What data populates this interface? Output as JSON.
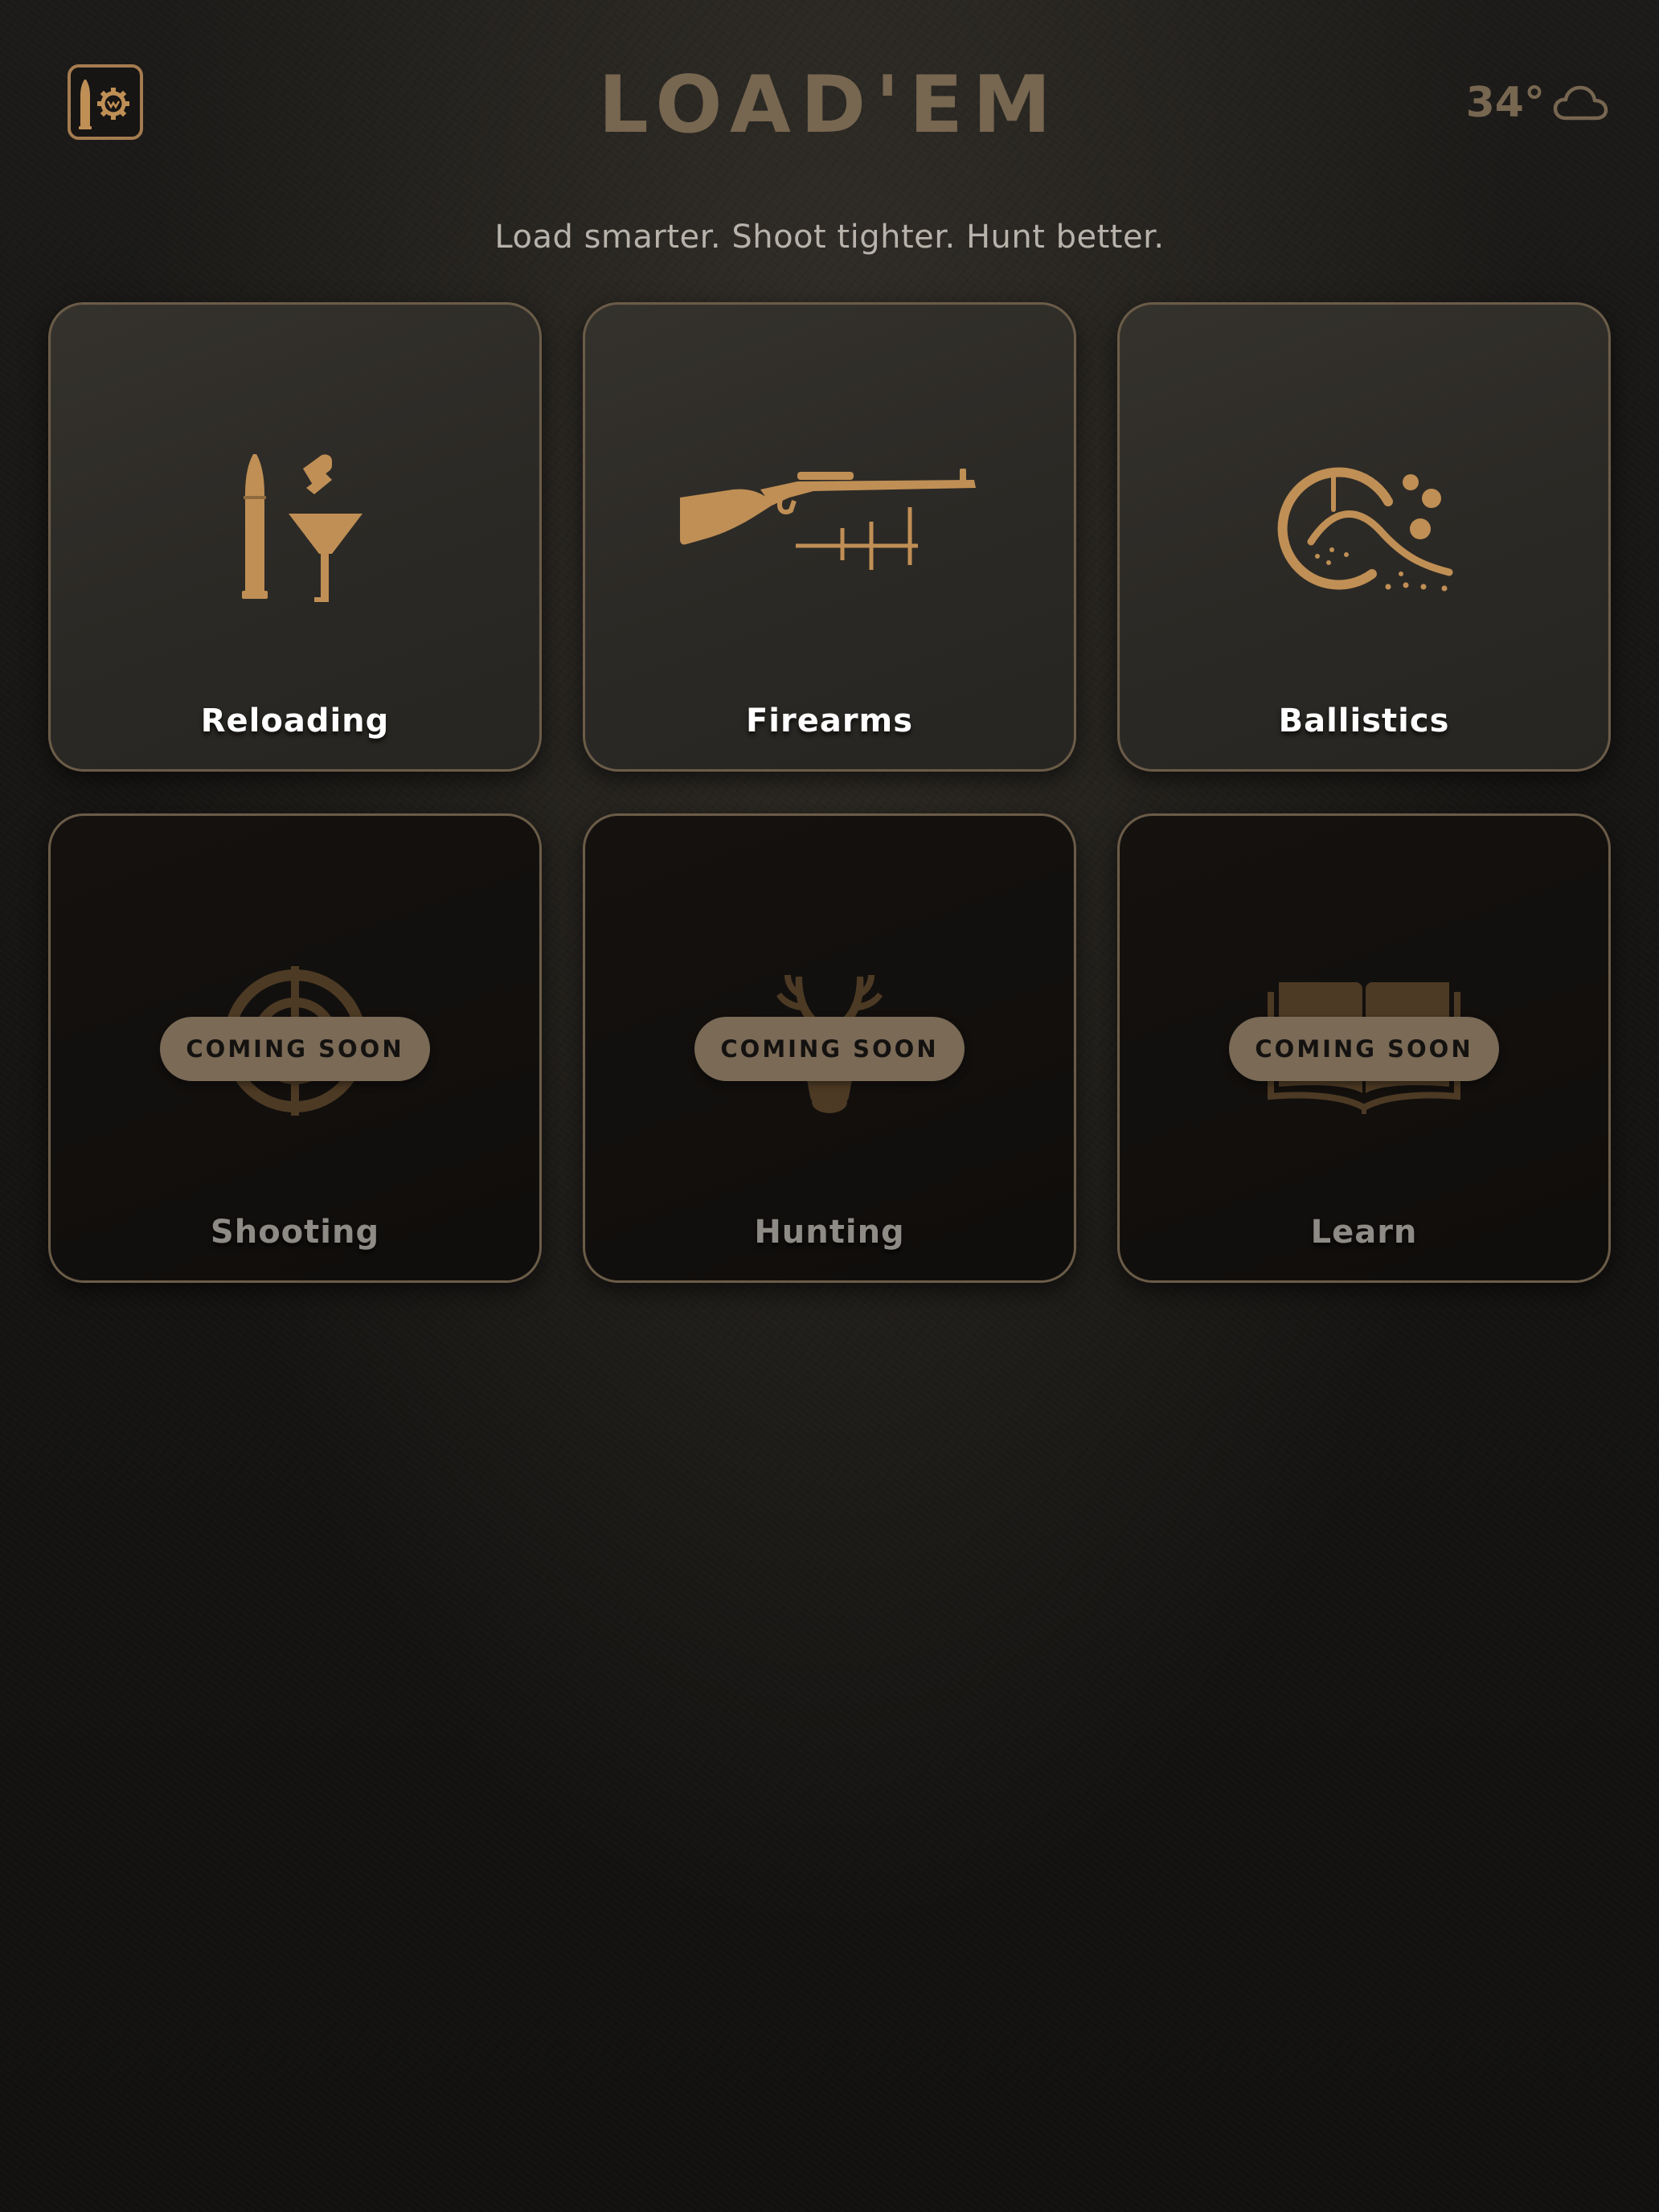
{
  "header": {
    "title": "LOAD'EM",
    "tagline": "Load smarter. Shoot tighter. Hunt better.",
    "weather": {
      "temperature": "34°",
      "condition_icon": "cloud-icon"
    },
    "logo_icon": "bullet-gear-icon"
  },
  "colors": {
    "accent_gold": "#c08f55",
    "title_brown": "#776650",
    "tile_border": "#6b5c48",
    "badge_bg": "#7a6a56"
  },
  "tiles": [
    {
      "label": "Reloading",
      "icon": "bullet-powder-icon",
      "status": "active"
    },
    {
      "label": "Firearms",
      "icon": "rifle-icon",
      "status": "active"
    },
    {
      "label": "Ballistics",
      "icon": "trajectory-icon",
      "status": "active"
    },
    {
      "label": "Shooting",
      "icon": "target-icon",
      "status": "coming_soon",
      "badge": "COMING SOON"
    },
    {
      "label": "Hunting",
      "icon": "deer-icon",
      "status": "coming_soon",
      "badge": "COMING SOON"
    },
    {
      "label": "Learn",
      "icon": "book-icon",
      "status": "coming_soon",
      "badge": "COMING SOON"
    }
  ]
}
